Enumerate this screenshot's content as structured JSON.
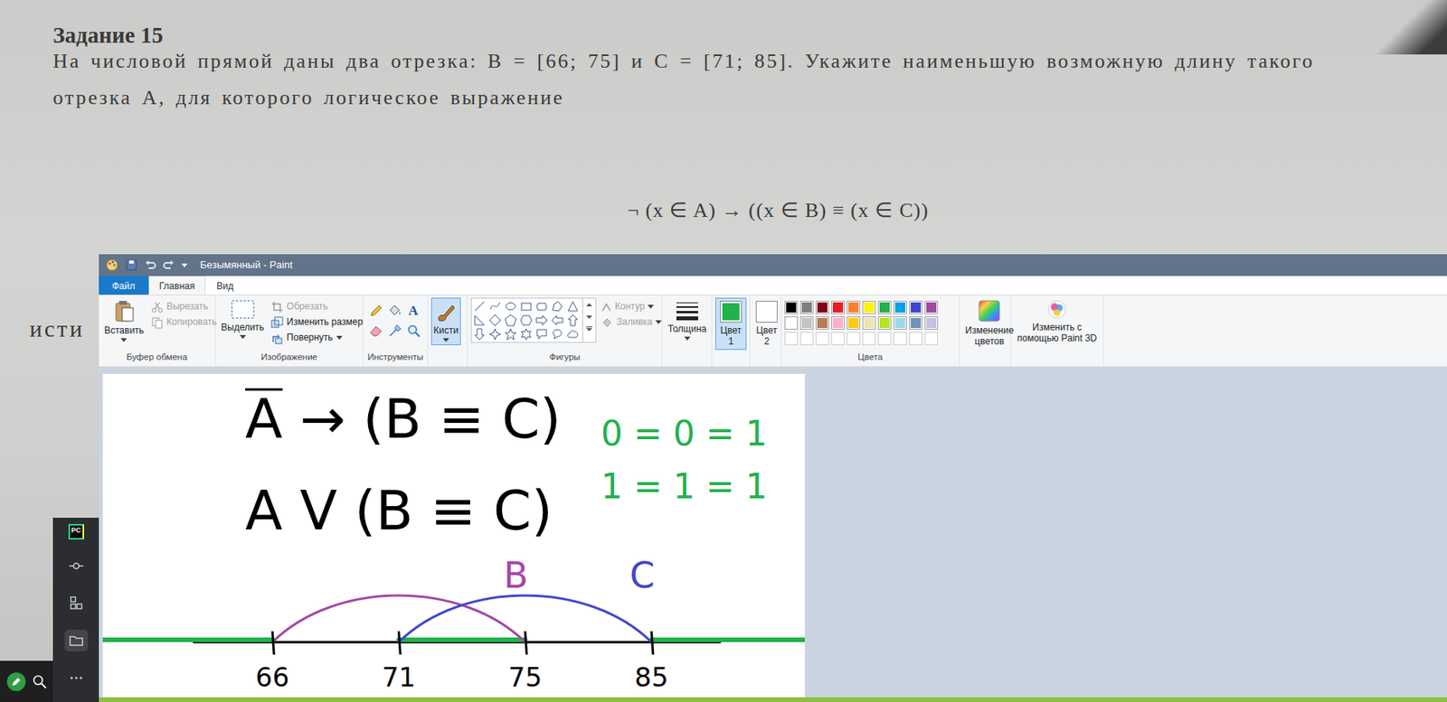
{
  "document": {
    "title": "Задание 15",
    "lines": [
      "На числовой прямой даны два отрезка: B = [66; 75] и C = [71; 85]. Укажите наименьшую возможную длину такого",
      "отрезка A, для которого логическое выражение"
    ],
    "formula": "¬ (x ∈ A) → ((x ∈ B) ≡ (x ∈ C))",
    "cut_word": "исти"
  },
  "paint": {
    "title": "Безымянный - Paint",
    "tabs": [
      {
        "label": "Файл",
        "kind": "menu",
        "selected": false
      },
      {
        "label": "Главная",
        "kind": "tab",
        "selected": true
      },
      {
        "label": "Вид",
        "kind": "tab",
        "selected": false
      }
    ],
    "groups": {
      "clipboard": {
        "label": "Буфер обмена",
        "paste": "Вставить",
        "cut": {
          "label": "Вырезать",
          "disabled": true
        },
        "copy": {
          "label": "Копировать",
          "disabled": true
        }
      },
      "image": {
        "label": "Изображение",
        "select": "Выделить",
        "crop": {
          "label": "Обрезать",
          "disabled": true
        },
        "resize": {
          "label": "Изменить размер",
          "disabled": false
        },
        "rotate": {
          "label": "Повернуть",
          "disabled": false
        }
      },
      "tools": {
        "label": "Инструменты",
        "text_tool": "A"
      },
      "brushes": {
        "label": "Кисти",
        "selected": true
      },
      "shapes": {
        "label": "Фигуры",
        "outline": {
          "label": "Контур",
          "disabled": true
        },
        "fill": {
          "label": "Заливка",
          "disabled": true
        }
      },
      "size": {
        "label": "Толщина"
      },
      "color1": {
        "label": "Цвет 1",
        "color": "#22b14c",
        "selected": true
      },
      "color2": {
        "label": "Цвет 2",
        "color": "#ffffff",
        "selected": false
      },
      "palette": {
        "label": "Цвета",
        "swatches": [
          {
            "color": "#000000"
          },
          {
            "color": "#7f7f7f"
          },
          {
            "color": "#880015"
          },
          {
            "color": "#ed1c24"
          },
          {
            "color": "#ff7f27"
          },
          {
            "color": "#fff200"
          },
          {
            "color": "#22b14c"
          },
          {
            "color": "#00a2e8"
          },
          {
            "color": "#3f48cc"
          },
          {
            "color": "#a349a4"
          },
          {
            "color": "#ffffff"
          },
          {
            "color": "#c3c3c3"
          },
          {
            "color": "#b97a57"
          },
          {
            "color": "#ffaec9"
          },
          {
            "color": "#ffc90e"
          },
          {
            "color": "#efe4b0"
          },
          {
            "color": "#b5e61d"
          },
          {
            "color": "#99d9ea"
          },
          {
            "color": "#7092be"
          },
          {
            "color": "#c8bfe7"
          },
          {
            "color": null
          },
          {
            "color": null
          },
          {
            "color": null
          },
          {
            "color": null
          },
          {
            "color": null
          },
          {
            "color": null
          },
          {
            "color": null
          },
          {
            "color": null
          },
          {
            "color": null
          },
          {
            "color": null
          }
        ]
      },
      "edit_colors": {
        "label": "Изменение цветов"
      },
      "paint3d": {
        "label": "Изменить с помощью Paint 3D"
      }
    }
  },
  "canvas": {
    "expressions": [
      {
        "head": "A",
        "negated": true,
        "rest": " → (B ≡ C)"
      },
      {
        "head": "A",
        "negated": false,
        "rest": " V (B ≡ C)"
      }
    ],
    "notes": [
      "0 = 0 = 1",
      "1 = 1 = 1"
    ],
    "axis": {
      "ticks": [
        "66",
        "71",
        "75",
        "85"
      ]
    },
    "segments": [
      {
        "label": "B",
        "from": "66",
        "to": "75",
        "color": "#a349a4"
      },
      {
        "label": "C",
        "from": "71",
        "to": "85",
        "color": "#3f48cc"
      }
    ],
    "answer": {
      "parts": [
        {
          "from": null,
          "to": "66"
        },
        {
          "from": "71",
          "to": "75"
        },
        {
          "from": "85",
          "to": null
        }
      ]
    }
  },
  "ide": {
    "logo": "PC",
    "tools": [
      {
        "kind": "commit",
        "selected": false
      },
      {
        "kind": "structure",
        "selected": false
      },
      {
        "kind": "project",
        "selected": true
      },
      {
        "kind": "more",
        "selected": false
      }
    ]
  }
}
